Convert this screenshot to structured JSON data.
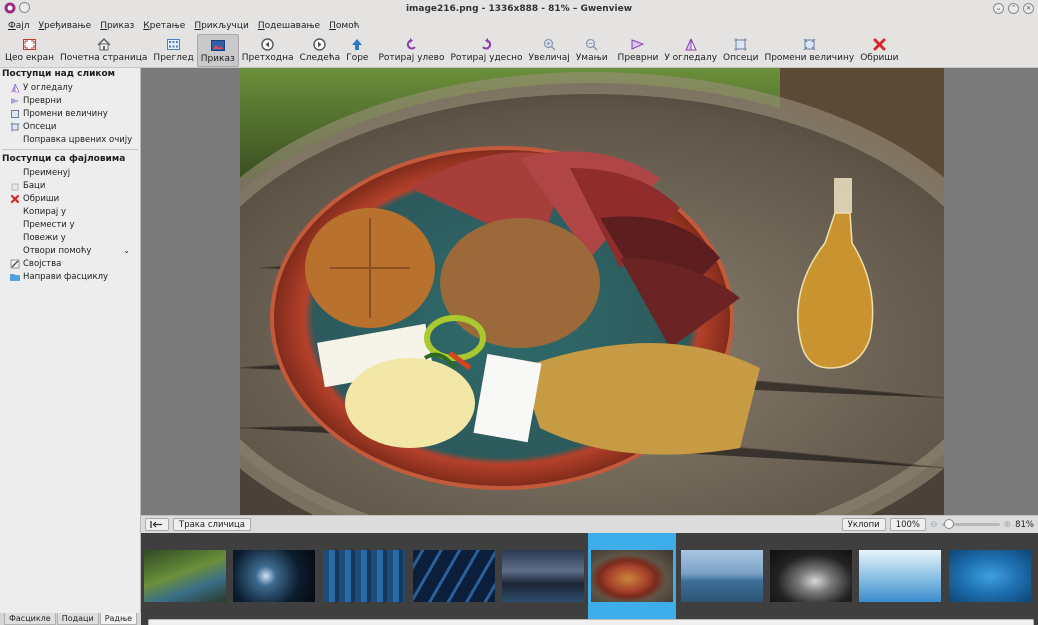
{
  "window": {
    "title": "image216.png - 1336x888 - 81% – Gwenview"
  },
  "menu": [
    "Фајл",
    "Уређивање",
    "Приказ",
    "Кретање",
    "Прикључци",
    "Подешавање",
    "Помоћ"
  ],
  "toolbar": {
    "fullscreen": "Цео екран",
    "home": "Почетна страница",
    "browse": "Преглед",
    "view": "Приказ",
    "previous": "Претходна",
    "next": "Следећа",
    "up": "Горе",
    "rotate_left": "Ротирај улево",
    "rotate_right": "Ротирај удесно",
    "zoom_in": "Увеличај",
    "zoom_out": "Умањи",
    "flip": "Преврни",
    "mirror": "У огледалу",
    "crop": "Опсеци",
    "resize": "Промени величину",
    "delete": "Обриши"
  },
  "sidebar": {
    "image_ops_title": "Поступци над сликом",
    "image_ops": [
      "У огледалу",
      "Преврни",
      "Промени величину",
      "Опсеци",
      "Поправка црвених очију"
    ],
    "file_ops_title": "Поступци са фајловима",
    "file_ops": [
      "Преименуј",
      "Баци",
      "Обриши",
      "Копирај у",
      "Премести у",
      "Повежи у",
      "Отвори помоћу",
      "Својства",
      "Направи фасциклу"
    ]
  },
  "bottom_tabs": [
    "Фасцикле",
    "Подаци",
    "Радње"
  ],
  "thumbbar": {
    "toggle_label": "Трака сличица",
    "fit_label": "Уклопи",
    "zoom_button": "100%",
    "zoom_percent": "81%"
  },
  "colors": {
    "selection": "#3daee9",
    "strip_bg": "#3f3f3f",
    "viewer_bg": "#7a7a7a"
  }
}
